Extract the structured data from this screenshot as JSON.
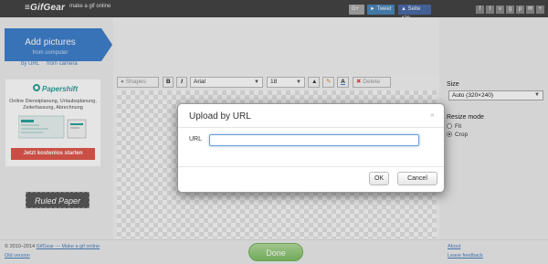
{
  "header": {
    "logo": "≡GifGear",
    "tagline": "make a gif online",
    "gplus_label": "G+",
    "tweet_label": "Tweet",
    "like_label": "Seite 479"
  },
  "left": {
    "add_pictures_label": "Add pictures",
    "add_pictures_sub": "from computer",
    "by_url": "by URL",
    "from_camera": "from camera",
    "ad": {
      "brand": "Papershift",
      "text": "Online Dienstplanung, Urlaubsplanung, Zeiterfassung, Abrechnung",
      "cta": "Jetzt kostenlos starten"
    },
    "ruled_paper": "Ruled Paper"
  },
  "toolbar": {
    "shapes": "Shapes",
    "bold": "B",
    "italic": "I",
    "font": "Arial",
    "font_size": "18",
    "color_label": "A",
    "delete": "Delete"
  },
  "right": {
    "size_label": "Size",
    "size_value": "Auto (320×240)",
    "resize_mode_label": "Resize mode",
    "fit": "Fit",
    "crop": "Crop",
    "selected_mode": "Crop"
  },
  "footer": {
    "copyright": "© 2010–2014",
    "brand_link": "GifGear — Make a gif online",
    "old_version": "Old version",
    "done": "Done",
    "about": "About",
    "leave_feedback": "Leave feedback"
  },
  "modal": {
    "title": "Upload by URL",
    "close": "×",
    "url_label": "URL",
    "url_value": "",
    "ok": "OK",
    "cancel": "Cancel"
  },
  "colors": {
    "topbar": "#444444",
    "add_button": "#3f7fcc",
    "done_button": "#8cc673",
    "ad_cta": "#e2574c",
    "brand_teal": "#2aa39a"
  }
}
